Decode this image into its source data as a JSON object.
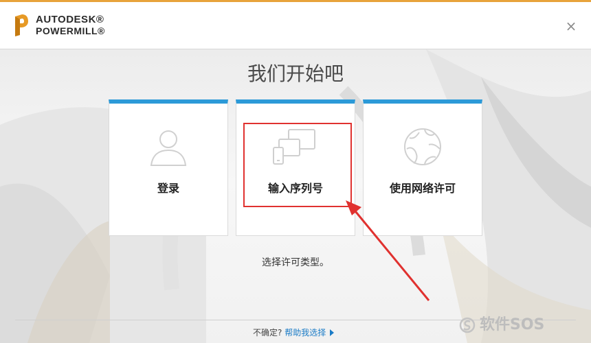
{
  "window": {
    "brand_line1": "AUTODESK®",
    "brand_line2": "POWERMILL®",
    "close_glyph": "×",
    "logo_icon": "autodesk-p-logo",
    "accent_color": "#e8a33c"
  },
  "main": {
    "heading": "我们开始吧",
    "subtext": "选择许可类型。"
  },
  "cards": [
    {
      "id": "login",
      "label": "登录",
      "icon": "person-icon"
    },
    {
      "id": "serial",
      "label": "输入序列号",
      "icon": "devices-icon"
    },
    {
      "id": "network",
      "label": "使用网络许可",
      "icon": "globe-icon"
    }
  ],
  "card_accent_color": "#2c9ad8",
  "annotation": {
    "highlight_color": "#e0312f",
    "arrow_color": "#e0312f"
  },
  "footer": {
    "prompt": "不确定?",
    "link": "帮助我选择"
  },
  "watermark": {
    "text": "软件SOS"
  }
}
